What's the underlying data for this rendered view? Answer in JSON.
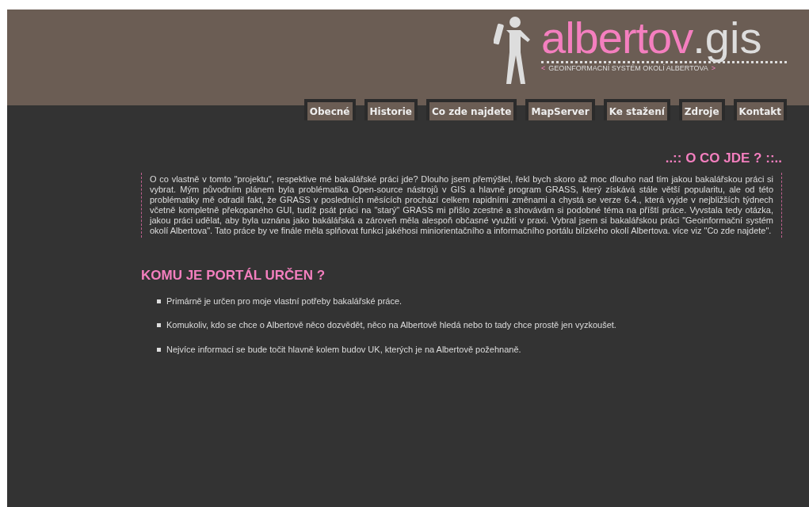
{
  "logo": {
    "name": "albertov",
    "suffix": ".gis",
    "subtitle_open": "<",
    "subtitle": "GEOINFORMACNÍ SYSTÉM OKOLÍ ALBERTOVA",
    "subtitle_close": ">"
  },
  "nav": [
    "Obecné",
    "Historie",
    "Co zde najdete",
    "MapServer",
    "Ke stažení",
    "Zdroje",
    "Kontakt"
  ],
  "intro": {
    "heading": "..:: O CO JDE ? ::..",
    "text": "O co vlastně v tomto \"projektu\", respektive mé bakalářské práci jde? Dlouho jsem přemýšlel, řekl bych skoro až moc dlouho nad tím jakou bakalářskou práci si vybrat. Mým původním plánem byla problématika Open-source nástrojů v GIS a hlavně program GRASS, který získává stále větší popularitu, ale od této problématiky mě odradil fakt, že GRASS v posledních měsících prochází celkem rapidními změnami a chystá se verze 6.4., která vyjde v nejbližších týdnech včetně kompletně překopaného GUI, tudíž psát práci na \"starý\" GRASS mi přišlo zcestné a shovávám si podobné téma na příští práce. Vyvstala tedy otázka, jakou práci udělat, aby byla uznána jako bakálářská a zároveň měla alespoň občasné využití v praxi. Vybral jsem si bakalářskou práci \"Geoinformační systém okolí Albertova\". Tato práce by ve finále měla splňovat funkci jakéhosi miniorientačního a informačního portálu blízkého okolí Albertova. více viz \"Co zde najdete\"."
  },
  "audience": {
    "heading": "KOMU JE PORTÁL URČEN ?",
    "items": [
      "Primárně je určen pro moje vlastní potřeby bakalářské práce.",
      "Komukoliv, kdo se chce o Albertově něco dozvědět, něco na Albertově hledá nebo to tady chce prostě jen vyzkoušet.",
      "Nejvíce informací se bude točit hlavně kolem budov UK, kterých je na Albertově požehnaně."
    ]
  }
}
